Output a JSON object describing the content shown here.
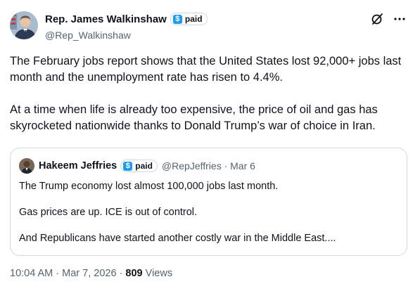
{
  "author": {
    "display_name": "Rep. James Walkinshaw",
    "badge_label": "paid",
    "handle": "@Rep_Walkinshaw"
  },
  "icons": {
    "badge": "dollar-icon",
    "grok": "slashed-circle-icon",
    "more": "more-dots-icon"
  },
  "tweet": {
    "paragraphs": [
      "The February jobs report shows that the United States lost 92,000+ jobs last month and the unemployment rate has risen to 4.4%.",
      "At a time when life is already too expensive, the price of oil and gas has skyrocketed nationwide thanks to Donald Trump’s war of choice in Iran."
    ]
  },
  "quoted": {
    "display_name": "Hakeem Jeffries",
    "badge_label": "paid",
    "meta": "@RepJeffries · Mar 6",
    "paragraphs": [
      "The Trump economy lost almost 100,000 jobs last month.",
      "Gas prices are up. ICE is out of control.",
      "And Republicans have started another costly war in the Middle East...."
    ]
  },
  "footer": {
    "timestamp": "10:04 AM · Mar 7, 2026 · ",
    "views_count": "809",
    "views_label": " Views"
  },
  "colors": {
    "accent": "#1d9bf0",
    "text_primary": "#0f1419",
    "text_secondary": "#536471",
    "border": "#cfd9de"
  }
}
